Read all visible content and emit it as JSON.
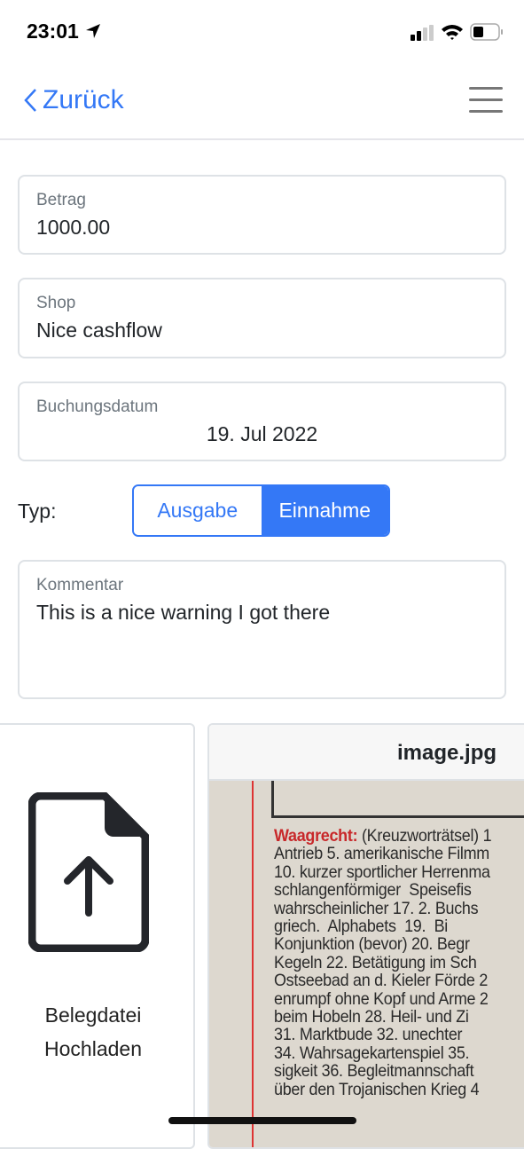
{
  "status_bar": {
    "time": "23:01",
    "icons": [
      "location-arrow-icon",
      "cellular-signal-icon",
      "wifi-icon",
      "battery-icon"
    ]
  },
  "nav": {
    "back_label": "Zurück",
    "menu_icon": "hamburger-menu-icon"
  },
  "form": {
    "amount": {
      "label": "Betrag",
      "value": "1000.00"
    },
    "shop": {
      "label": "Shop",
      "value": "Nice cashflow"
    },
    "date": {
      "label": "Buchungsdatum",
      "value": "19. Jul 2022"
    },
    "type": {
      "label": "Typ:",
      "options": [
        "Ausgabe",
        "Einnahme"
      ],
      "selected": "Einnahme"
    },
    "comment": {
      "label": "Kommentar",
      "value": "This is a nice warning I got there"
    }
  },
  "attachments": {
    "upload": {
      "line1": "Belegdatei",
      "line2": "Hochladen",
      "icon": "file-upload-icon"
    },
    "image": {
      "filename": "image.jpg",
      "photo_heading": "Waagrecht:",
      "photo_lines": [
        "(Kreuzworträtsel) 1",
        "Antrieb 5. amerikanische Filmm",
        "10. kurzer sportlicher Herrenma",
        "schlangenförmiger  Speisefis",
        "wahrscheinlicher 17. 2. Buchs",
        "griech.  Alphabets  19.  Bi",
        "Konjunktion (bevor) 20. Begr",
        "Kegeln 22. Betätigung im Sch",
        "Ostseebad an d. Kieler Förde 2",
        "enrumpf ohne Kopf und Arme 2",
        "beim Hobeln 28. Heil- und Zi",
        "31. Marktbude 32. unechter",
        "34. Wahrsagekartenspiel 35.",
        "sigkeit 36. Begleitmannschaft",
        "über den Trojanischen Krieg 4"
      ]
    }
  },
  "colors": {
    "accent": "#3478f6",
    "border": "#dee2e6",
    "label": "#6c757d"
  }
}
